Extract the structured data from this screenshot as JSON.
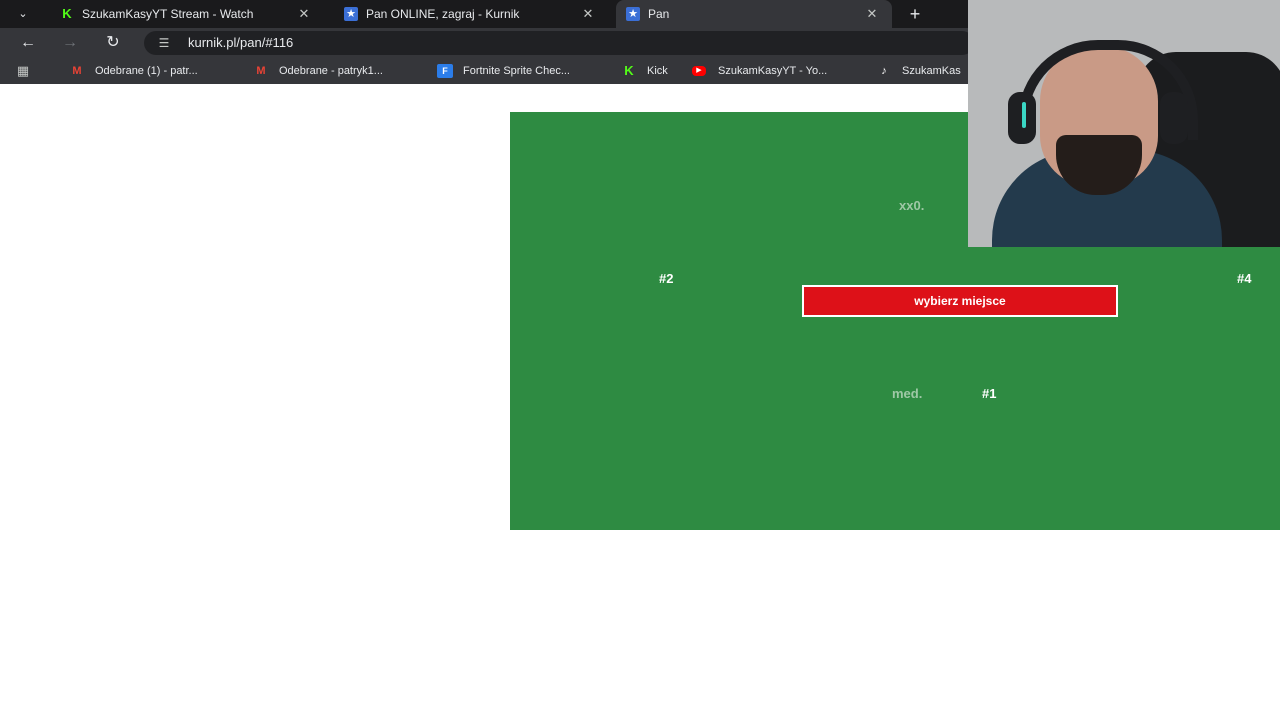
{
  "browser": {
    "tabs": [
      {
        "title": "SzukamKasyYT Stream - Watch",
        "icon": "kick-icon",
        "active": false
      },
      {
        "title": "Pan ONLINE, zagraj - Kurnik",
        "icon": "star-icon",
        "active": false
      },
      {
        "title": "Pan",
        "icon": "star-icon",
        "active": true
      }
    ],
    "tab_close": "✕",
    "new_tab": "+",
    "address": "kurnik.pl/pan/#116",
    "bookmarks": [
      {
        "label": "Odebrane (1) - patr...",
        "icon": "gmail-icon",
        "glyph": "M"
      },
      {
        "label": "Odebrane - patryk1...",
        "icon": "gmail-icon",
        "glyph": "M"
      },
      {
        "label": "Fortnite Sprite Chec...",
        "icon": "fortnite-icon",
        "glyph": "F"
      },
      {
        "label": "Kick",
        "icon": "kick-icon",
        "glyph": "K"
      },
      {
        "label": "SzukamKasyYT - Yo...",
        "icon": "youtube-icon",
        "glyph": "▶"
      },
      {
        "label": "SzukamKas",
        "icon": "tiktok-icon",
        "glyph": "♪"
      }
    ]
  },
  "game": {
    "players": {
      "top_name": "xx0.",
      "left_slot": "#2",
      "right_slot": "#4",
      "bottom_name": "med.",
      "bottom_slot": "#1"
    },
    "choose_seat_label": "wybierz miejsce",
    "board_color": "#2e8b42",
    "button_color": "#dd1118"
  }
}
